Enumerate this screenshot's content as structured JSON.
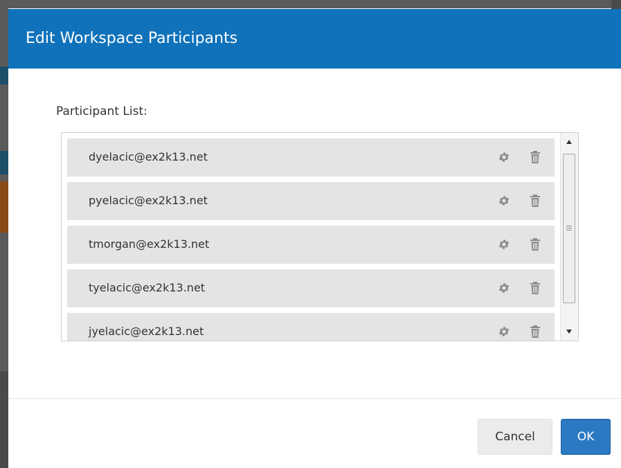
{
  "dialog": {
    "title": "Edit Workspace Participants",
    "participant_list_label": "Participant List:"
  },
  "participants": [
    {
      "email": "dyelacic@ex2k13.net"
    },
    {
      "email": "pyelacic@ex2k13.net"
    },
    {
      "email": "tmorgan@ex2k13.net"
    },
    {
      "email": "tyelacic@ex2k13.net"
    },
    {
      "email": "jyelacic@ex2k13.net"
    }
  ],
  "row_icons": [
    "gear-icon",
    "trash-icon"
  ],
  "buttons": {
    "cancel": "Cancel",
    "ok": "OK"
  },
  "colors": {
    "header": "#0f72ba",
    "row": "#e4e4e4",
    "ok_button": "#2b79c2",
    "icon": "#8c8c8c"
  }
}
